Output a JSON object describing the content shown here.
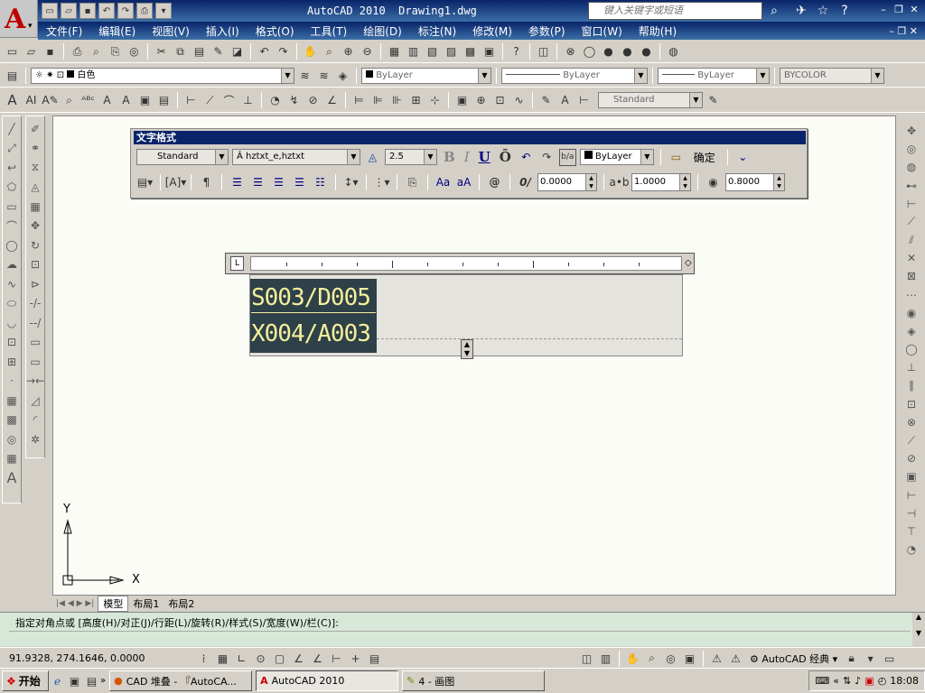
{
  "window": {
    "app_title": "AutoCAD 2010",
    "doc_title": "Drawing1.dwg",
    "search_placeholder": "键入关键字或短语"
  },
  "menu": [
    "文件(F)",
    "编辑(E)",
    "视图(V)",
    "插入(I)",
    "格式(O)",
    "工具(T)",
    "绘图(D)",
    "标注(N)",
    "修改(M)",
    "参数(P)",
    "窗口(W)",
    "帮助(H)"
  ],
  "layer_toolbar": {
    "layer_name": "白色",
    "color": "ByLayer",
    "linetype": "ByLayer",
    "lineweight": "ByLayer",
    "plot_style": "BYCOLOR"
  },
  "styles_toolbar": {
    "dim_style": "Standard"
  },
  "text_format": {
    "title": "文字格式",
    "style": "Standard",
    "font": "hztxt_e,hztxt",
    "height": "2.5",
    "bold": "B",
    "italic": "I",
    "underline": "U",
    "overline": "Ō",
    "color": "ByLayer",
    "ok_label": "确定",
    "oblique": "0.0000",
    "tracking": "1.0000",
    "width_factor": "0.8000",
    "case_upper": "Aa",
    "case_lower": "aA",
    "symbol": "@"
  },
  "editor": {
    "line1": "S003/D005",
    "line2": "X004/A003"
  },
  "ucs": {
    "x": "X",
    "y": "Y"
  },
  "layout_tabs": [
    "模型",
    "布局1",
    "布局2"
  ],
  "command": "指定对角点或 [高度(H)/对正(J)/行距(L)/旋转(R)/样式(S)/宽度(W)/栏(C)]:",
  "status": {
    "coords": "91.9328, 274.1646, 0.0000",
    "workspace": "AutoCAD 经典"
  },
  "taskbar": {
    "start": "开始",
    "tasks": [
      "CAD 堆叠 - 『AutoCA...",
      "AutoCAD 2010",
      "4 - 画图"
    ],
    "clock": "18:08"
  }
}
